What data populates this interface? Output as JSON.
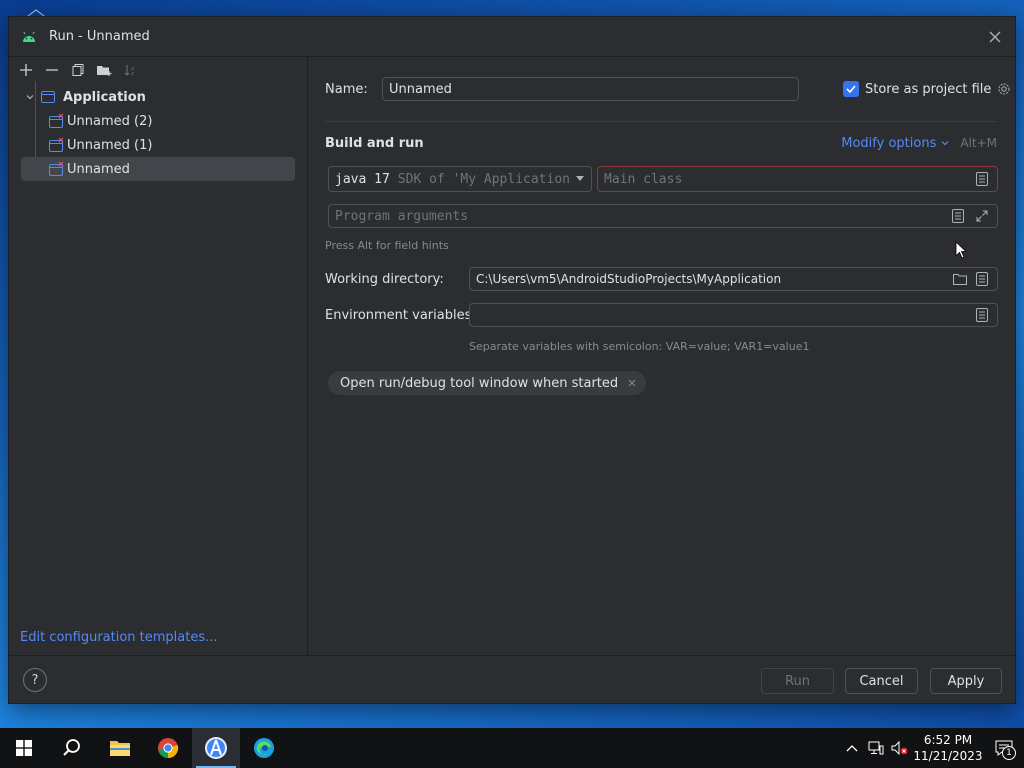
{
  "window": {
    "title": "Run - Unnamed",
    "app_icon": "android-icon"
  },
  "toolbar": {
    "icons": [
      "add-icon",
      "remove-icon",
      "copy-icon",
      "new-folder-icon",
      "sort-icon"
    ]
  },
  "tree": {
    "root": "Application",
    "items": [
      "Unnamed (2)",
      "Unnamed (1)",
      "Unnamed"
    ],
    "selected_index": 2
  },
  "left_footer": {
    "edit_templates": "Edit configuration templates..."
  },
  "form": {
    "name_label": "Name:",
    "name_value": "Unnamed",
    "store_label": "Store as project file",
    "store_checked": true,
    "build_run_title": "Build and run",
    "modify_options": "Modify options",
    "modify_shortcut": "Alt+M",
    "sdk_value": "java 17",
    "sdk_detail": "SDK of 'My Application",
    "main_class_placeholder": "Main class",
    "program_args_placeholder": "Program arguments",
    "field_hint": "Press Alt for field hints",
    "working_dir_label": "Working directory:",
    "working_dir_value": "C:\\Users\\vm5\\AndroidStudioProjects\\MyApplication",
    "env_label": "Environment variables:",
    "env_value": "",
    "env_hint": "Separate variables with semicolon: VAR=value; VAR1=value1",
    "chip_label": "Open run/debug tool window when started"
  },
  "footer": {
    "help": "?",
    "run": "Run",
    "cancel": "Cancel",
    "apply": "Apply"
  },
  "taskbar": {
    "apps": [
      "windows-start-icon",
      "search-icon",
      "file-explorer-icon",
      "chrome-icon",
      "android-studio-icon",
      "edge-icon"
    ],
    "time": "6:52 PM",
    "date": "11/21/2023",
    "notification_count": "1"
  },
  "colors": {
    "accent": "#3574f0",
    "link": "#548af7",
    "error_border": "#8c3a3a",
    "bg": "#2b2d30"
  }
}
